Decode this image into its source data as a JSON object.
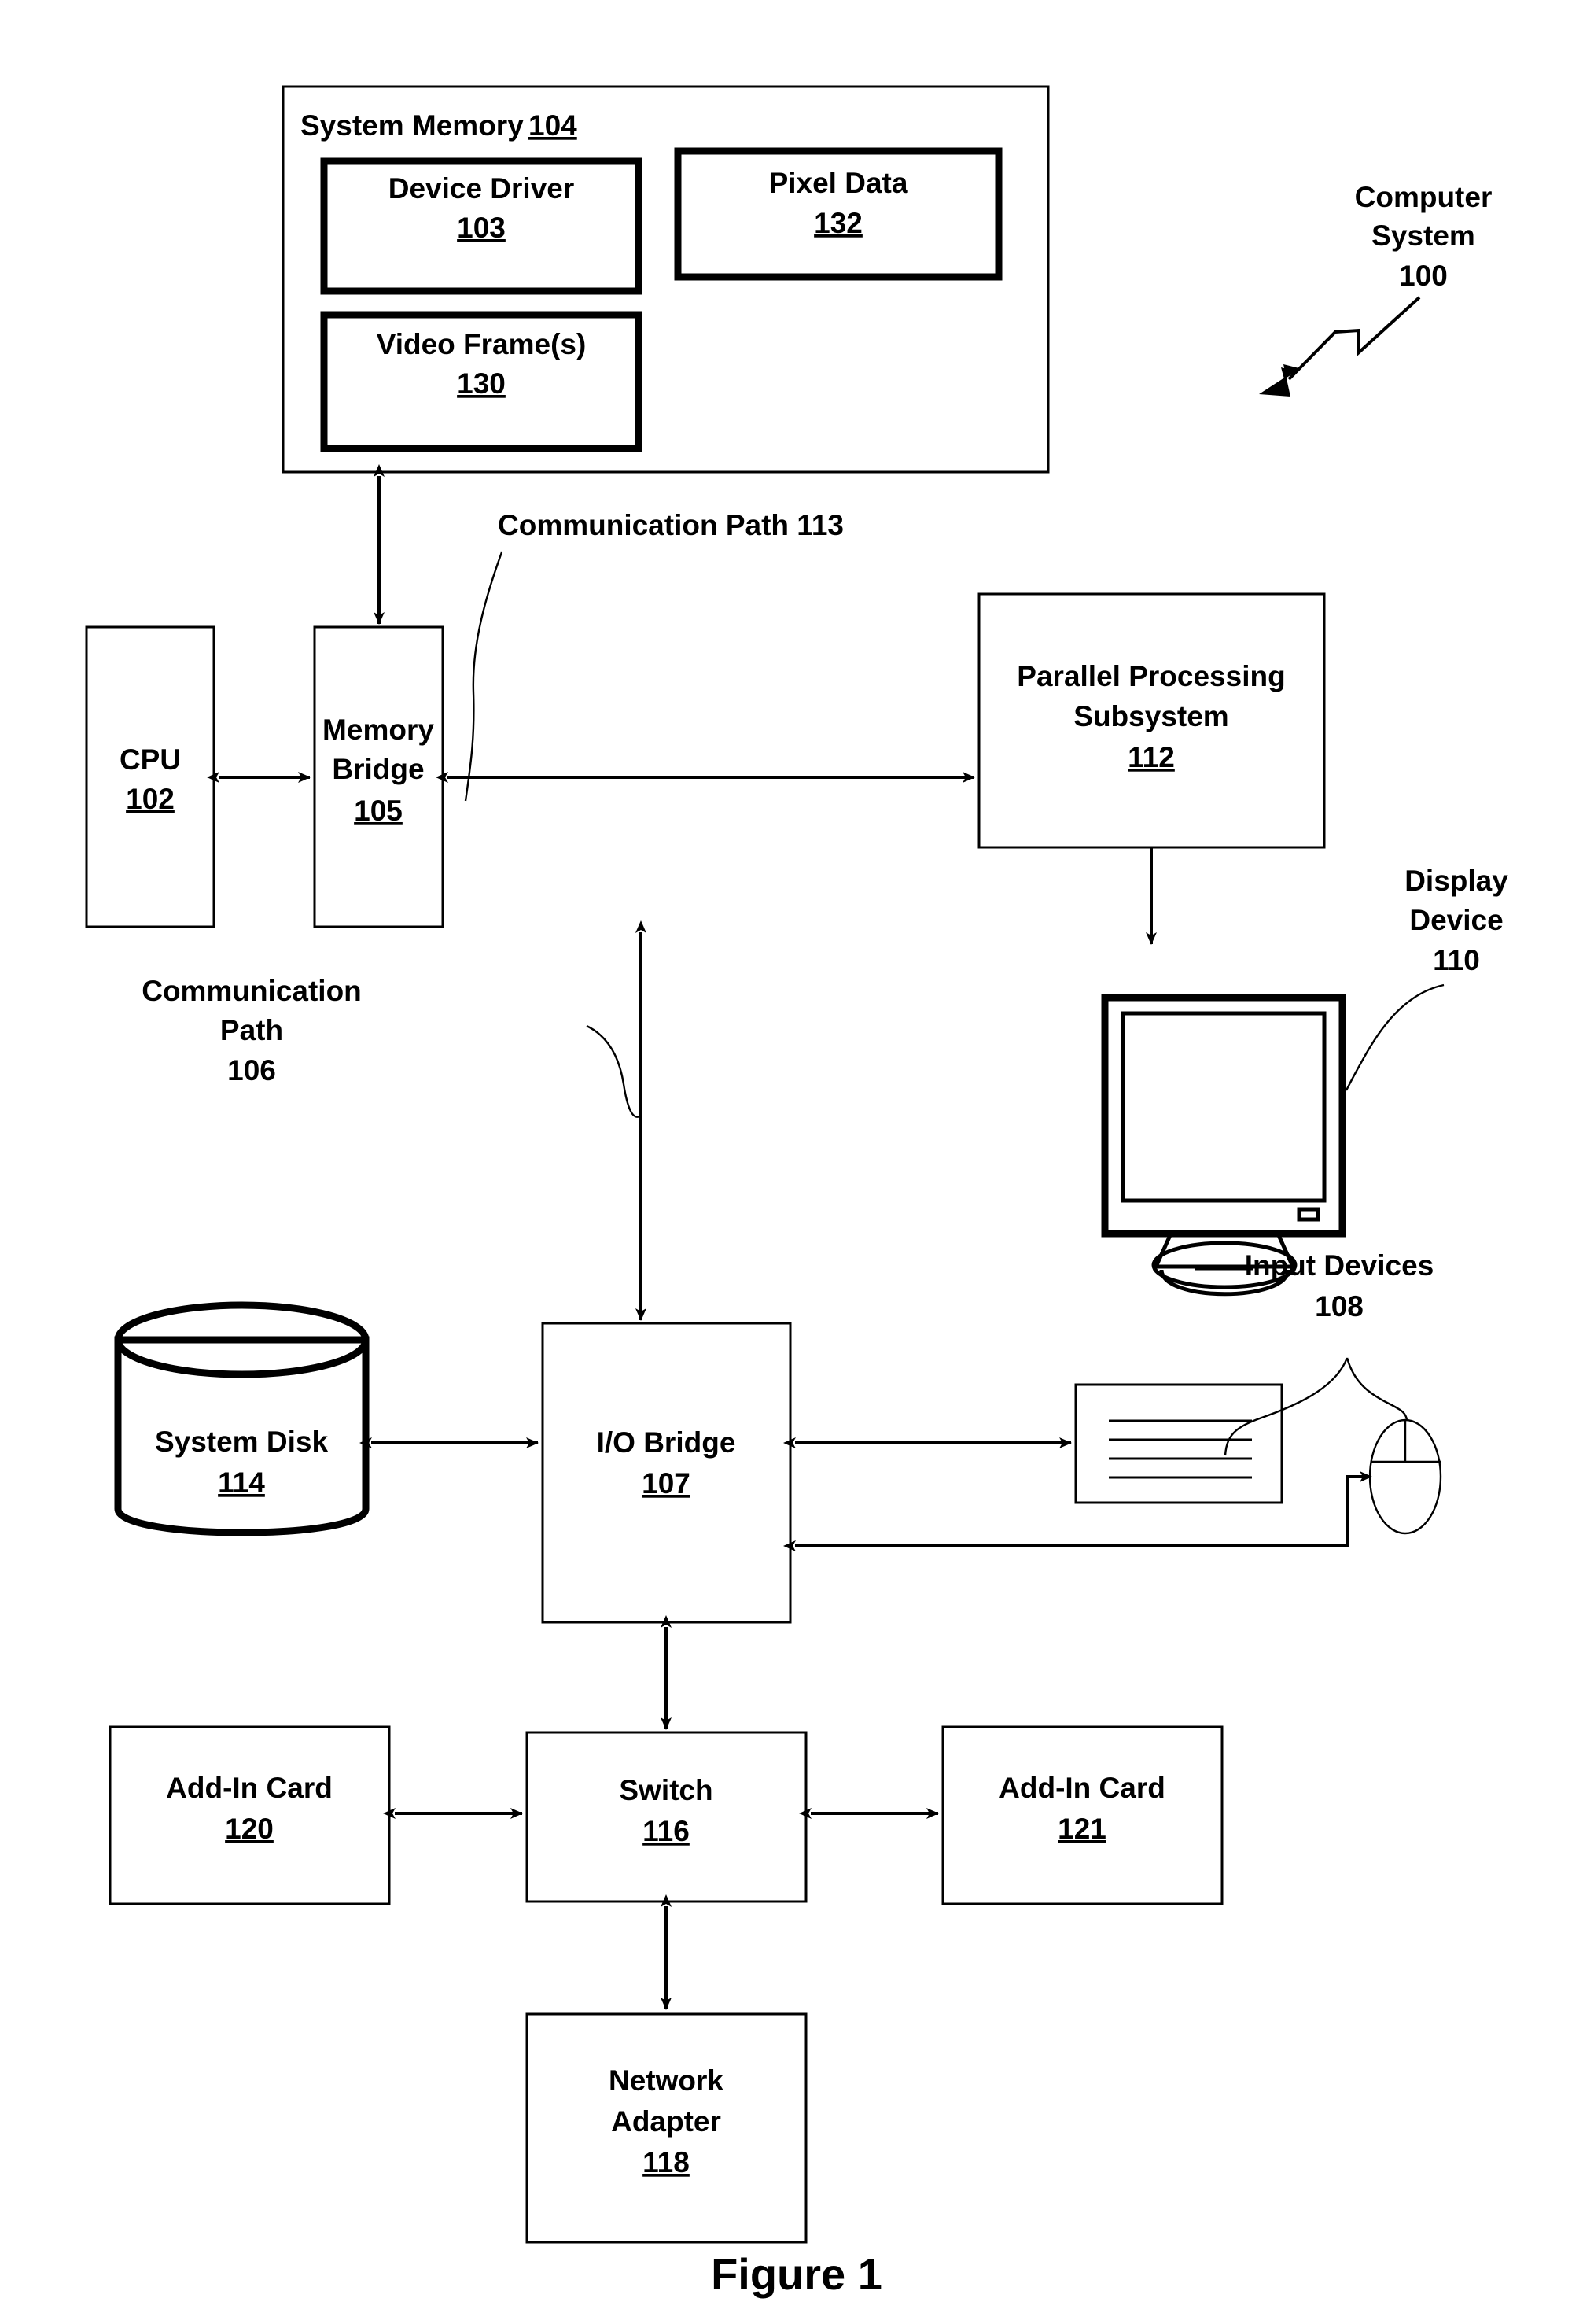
{
  "figure": {
    "caption": "Figure 1",
    "system_callout": {
      "line1": "Computer",
      "line2": "System",
      "ref": "100"
    }
  },
  "blocks": {
    "system_memory": {
      "title": "System Memory",
      "ref": "104",
      "children": [
        {
          "key": "device_driver",
          "label": "Device Driver",
          "ref": "103"
        },
        {
          "key": "pixel_data",
          "label": "Pixel Data",
          "ref": "132"
        },
        {
          "key": "video_frames",
          "label": "Video Frame(s)",
          "ref": "130"
        }
      ]
    },
    "cpu": {
      "label": "CPU",
      "ref": "102"
    },
    "memory_bridge": {
      "line1": "Memory",
      "line2": "Bridge",
      "ref": "105"
    },
    "parallel_processing": {
      "line1": "Parallel Processing",
      "line2": "Subsystem",
      "ref": "112"
    },
    "display_device": {
      "line1": "Display",
      "line2": "Device",
      "ref": "110"
    },
    "input_devices": {
      "line1": "Input Devices",
      "ref": "108"
    },
    "system_disk": {
      "label": "System Disk",
      "ref": "114"
    },
    "io_bridge": {
      "label": "I/O Bridge",
      "ref": "107"
    },
    "add_in_card_left": {
      "label": "Add-In Card",
      "ref": "120"
    },
    "switch": {
      "label": "Switch",
      "ref": "116"
    },
    "add_in_card_right": {
      "label": "Add-In Card",
      "ref": "121"
    },
    "network_adapter": {
      "line1": "Network",
      "line2": "Adapter",
      "ref": "118"
    }
  },
  "annotations": {
    "comm_path_113": {
      "line1": "Communication Path 113"
    },
    "comm_path_106": {
      "line1": "Communication",
      "line2": "Path",
      "line3": "106"
    }
  },
  "colors": {
    "ink": "#000000",
    "paper": "#ffffff"
  }
}
